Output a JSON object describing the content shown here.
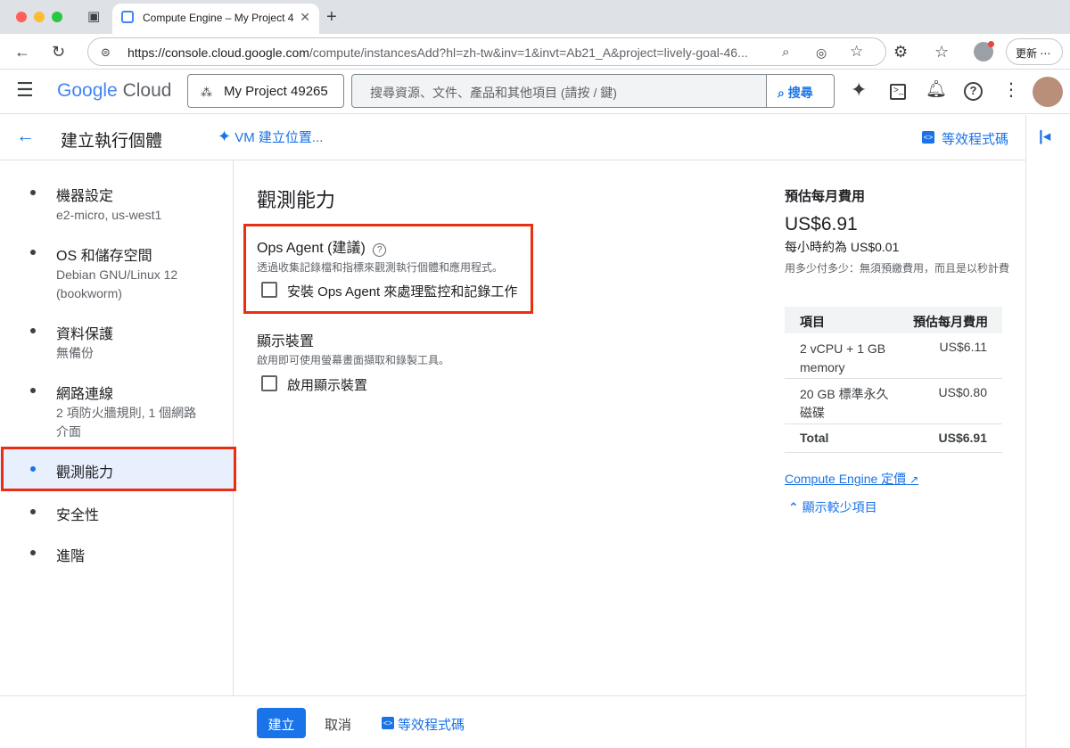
{
  "browser": {
    "tab_title": "Compute Engine – My Project 4",
    "url_host": "https://console.cloud.google.com",
    "url_path": "/compute/instancesAdd?hl=zh-tw&inv=1&invt=Ab21_A&project=lively-goal-46...",
    "update_label": "更新"
  },
  "header": {
    "logo_google": "Google",
    "logo_cloud": "Cloud",
    "project_name": "My Project 49265",
    "search_placeholder": "搜尋資源、文件、產品和其他項目 (請按 / 鍵)",
    "search_button": "搜尋"
  },
  "subheader": {
    "title": "建立執行個體",
    "vm_location": "VM 建立位置...",
    "equivalent_code": "等效程式碼"
  },
  "nav": {
    "items": [
      {
        "label": "機器設定",
        "sub": "e2-micro, us-west1"
      },
      {
        "label": "OS 和儲存空間",
        "sub": "Debian GNU/Linux 12 (bookworm)"
      },
      {
        "label": "資料保護",
        "sub": "無備份"
      },
      {
        "label": "網路連線",
        "sub": "2 項防火牆規則, 1 個網路介面"
      },
      {
        "label": "觀測能力",
        "sub": ""
      },
      {
        "label": "安全性",
        "sub": ""
      },
      {
        "label": "進階",
        "sub": ""
      }
    ]
  },
  "main": {
    "heading": "觀測能力",
    "ops_title": "Ops Agent (建議)",
    "ops_desc": "透過收集記錄檔和指標來觀測執行個體和應用程式。",
    "ops_checkbox": "安裝 Ops Agent 來處理監控和記錄工作",
    "display_title": "顯示裝置",
    "display_desc": "啟用即可使用螢幕畫面擷取和錄製工具。",
    "display_checkbox": "啟用顯示裝置"
  },
  "cost": {
    "title": "預估每月費用",
    "monthly": "US$6.91",
    "hourly": "每小時約為 US$0.01",
    "note": "用多少付多少：無須預繳費用，而且是以秒計費",
    "col_item": "項目",
    "col_cost": "預估每月費用",
    "rows": [
      {
        "item": "2 vCPU + 1 GB memory",
        "cost": "US$6.11"
      },
      {
        "item": "20 GB 標準永久磁碟",
        "cost": "US$0.80"
      }
    ],
    "total_label": "Total",
    "total_value": "US$6.91",
    "pricing_link": "Compute Engine 定價",
    "show_less": "顯示較少項目"
  },
  "footer": {
    "create": "建立",
    "cancel": "取消",
    "equivalent_code": "等效程式碼"
  },
  "colors": {
    "accent": "#1a73e8",
    "highlight_box": "#ea2e12"
  }
}
